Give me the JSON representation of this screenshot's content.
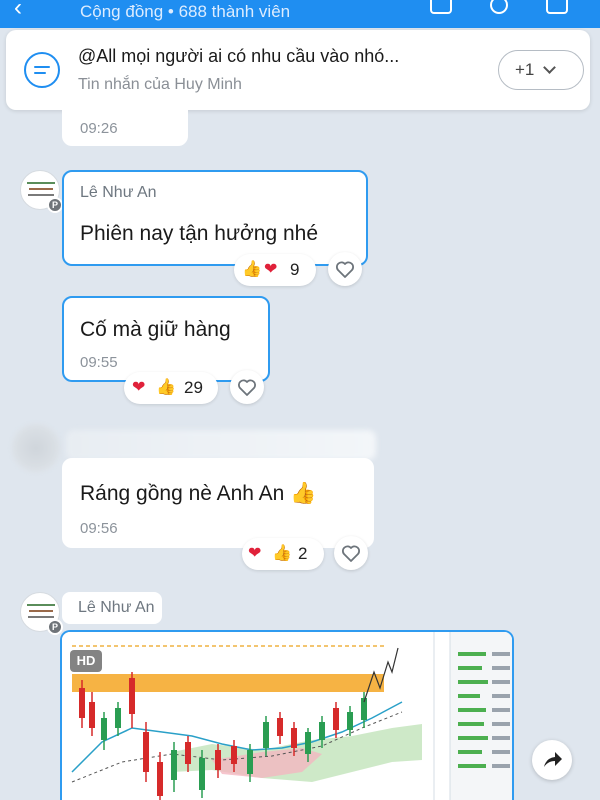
{
  "header": {
    "subtitle": "Cộng đồng • 688 thành viên"
  },
  "pinned": {
    "title": "@All mọi người ai có nhu cầu vào nhó...",
    "subtitle": "Tin nhắn của Huy Minh",
    "more_label": "+1"
  },
  "messages": [
    {
      "time": "09:26"
    },
    {
      "sender": "Lê Như An",
      "text": "Phiên nay tận hưởng nhé",
      "reactions": {
        "count": "9"
      }
    },
    {
      "text": "Cố mà giữ hàng",
      "time": "09:55",
      "reactions": {
        "count": "29"
      }
    },
    {
      "text": "Ráng gồng nè Anh An",
      "emoji": "👍",
      "time": "09:56",
      "reactions": {
        "count": "2"
      }
    },
    {
      "sender": "Lê Như An",
      "image_badge": "HD"
    }
  ],
  "icons": {
    "thumb": "👍",
    "heart": "❤",
    "accent": "#2f9bf0"
  }
}
